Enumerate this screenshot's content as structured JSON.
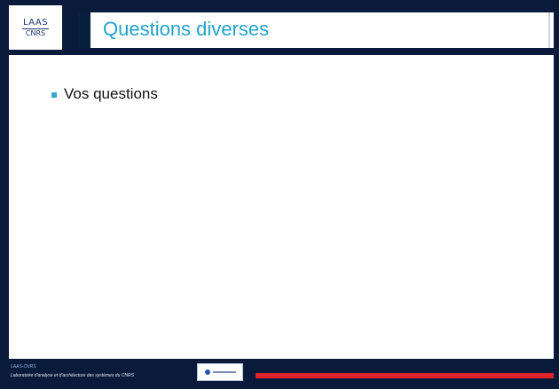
{
  "logo": {
    "line1": "LAAS",
    "line2": "CNRS"
  },
  "title": "Questions diverses",
  "bullets": [
    "Vos questions"
  ],
  "footer": {
    "line1": "LAAS-CNRS",
    "line2": "Laboratoire d'analyse et d'architecture des systèmes du CNRS"
  },
  "colors": {
    "navy": "#0a1a3a",
    "title_cyan": "#21a3c8",
    "accent_red": "#e0232a"
  }
}
